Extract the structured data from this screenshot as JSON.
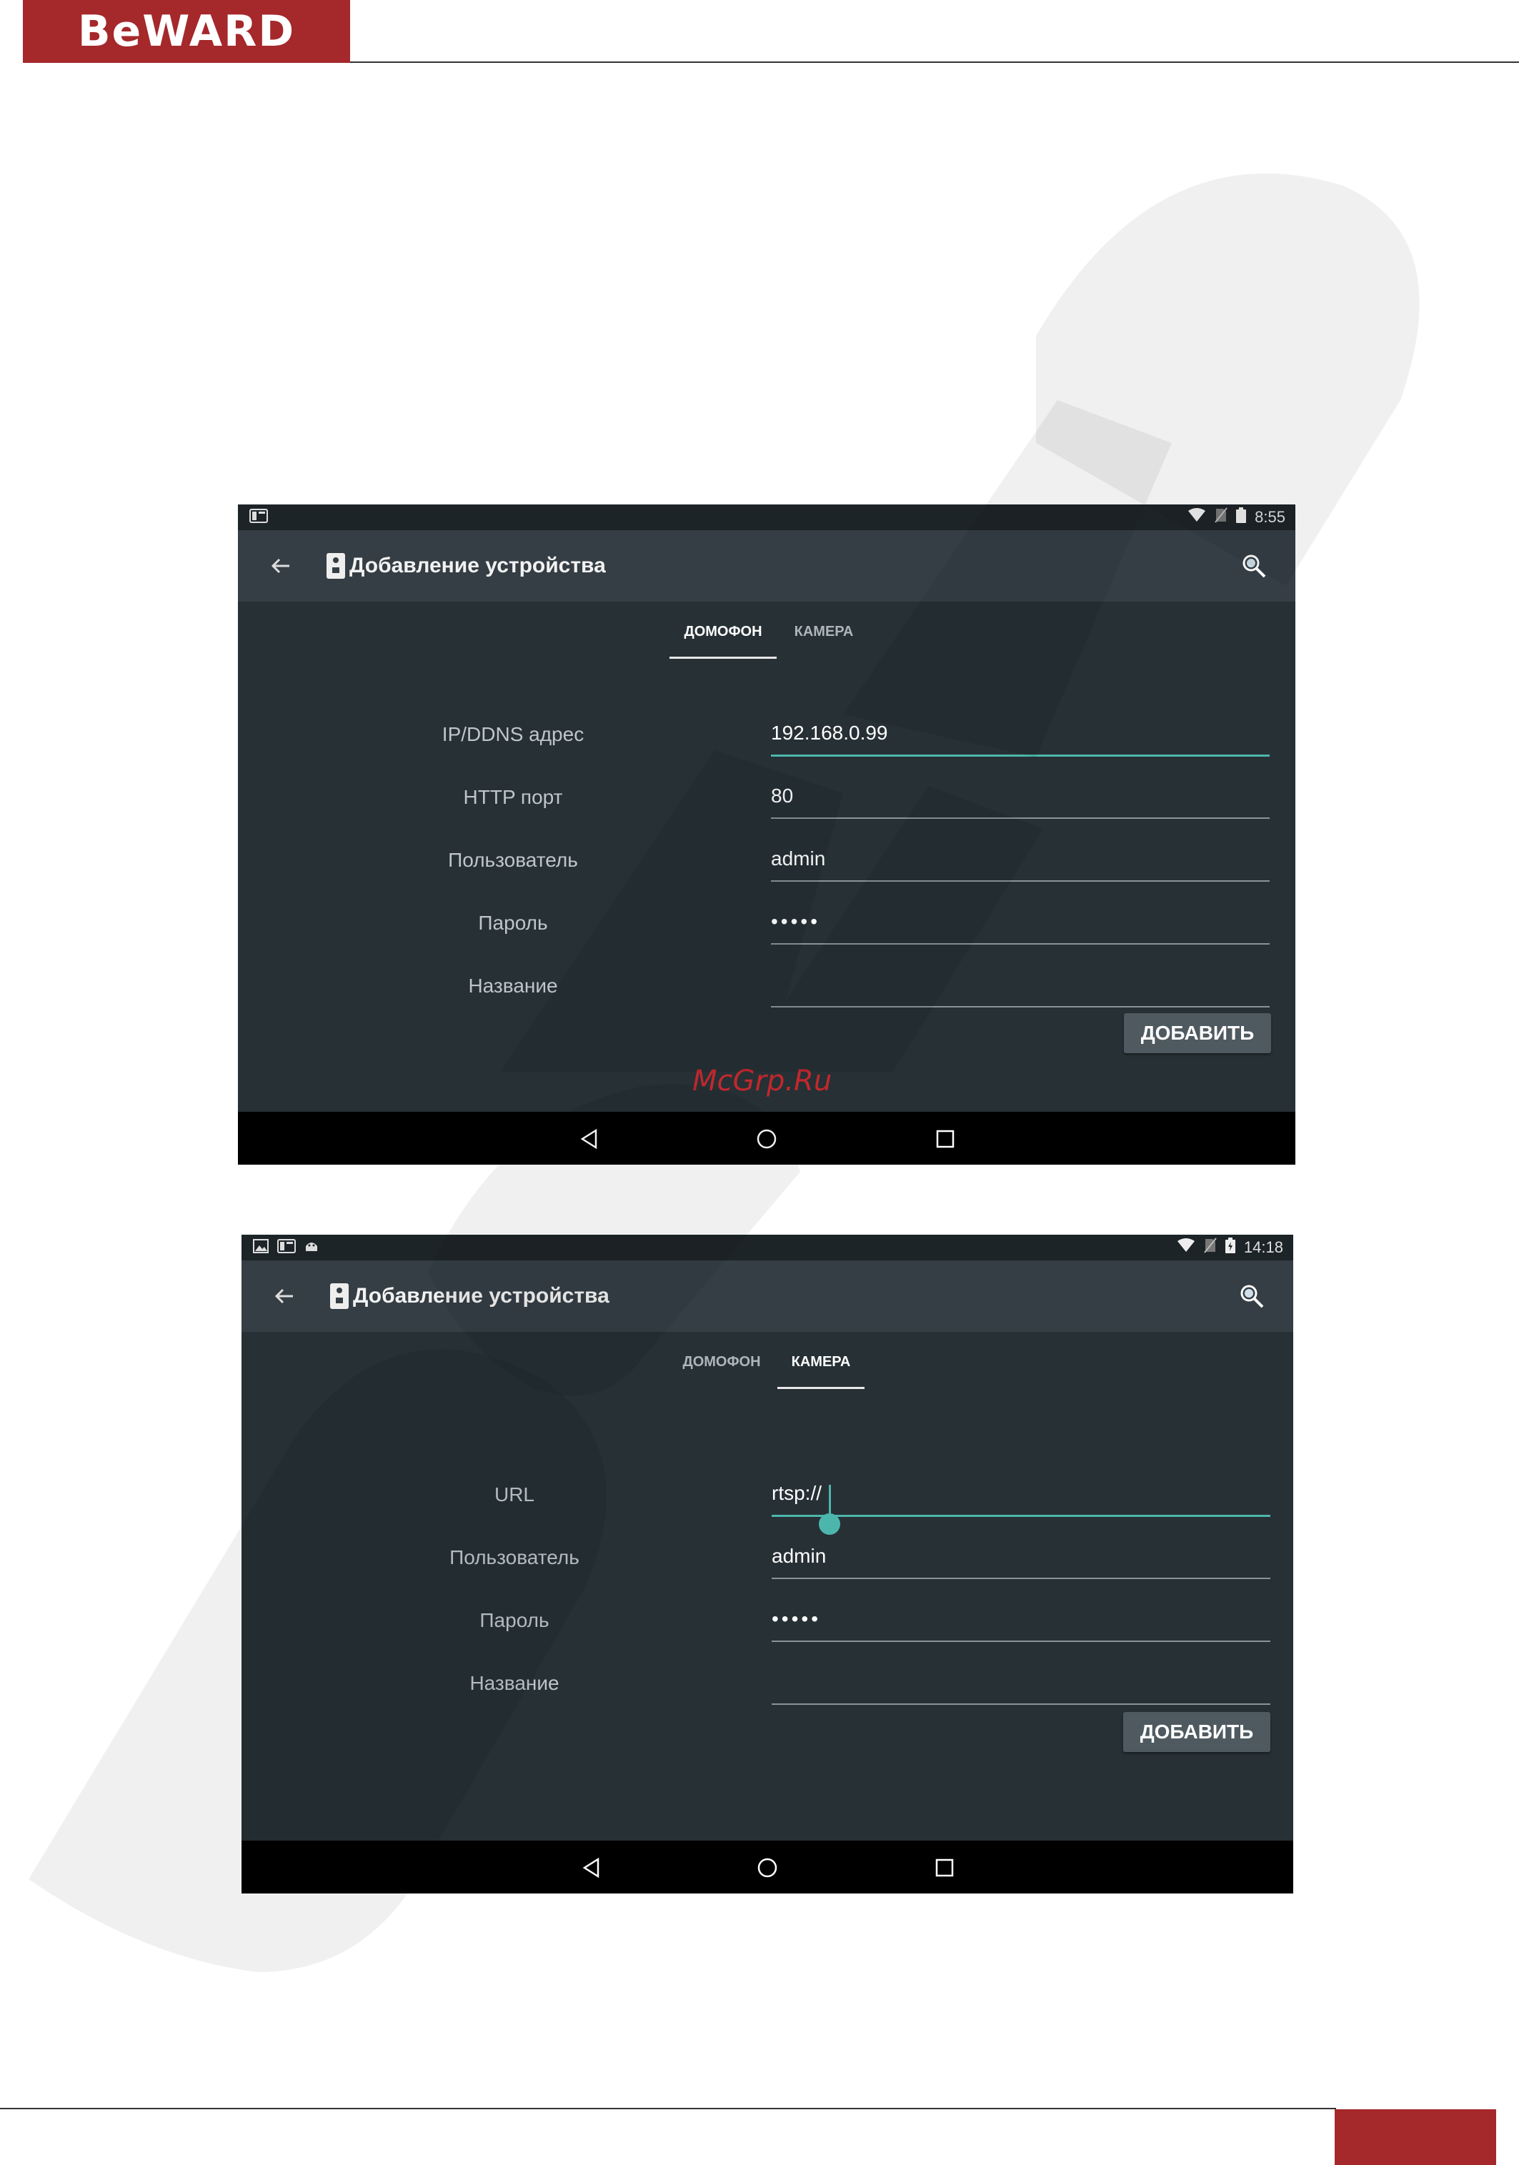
{
  "document": {
    "brand": "BeWARD"
  },
  "colors": {
    "brand_red": "#a5282b",
    "accent_teal": "#4db6ac",
    "screen_bg": "#263035",
    "app_bar": "#353e44"
  },
  "screen1": {
    "status_time": "8:55",
    "title": "Добавление устройства",
    "tabs": [
      {
        "label": "ДОМОФОН",
        "active": true
      },
      {
        "label": "КАМЕРА",
        "active": false
      }
    ],
    "fields": [
      {
        "label": "IP/DDNS адрес",
        "value": "192.168.0.99",
        "focused": true
      },
      {
        "label": "HTTP порт",
        "value": "80"
      },
      {
        "label": "Пользователь",
        "value": "admin"
      },
      {
        "label": "Пароль",
        "value": "•••••"
      },
      {
        "label": "Название",
        "value": ""
      }
    ],
    "add_button": "ДОБАВИТЬ",
    "site_watermark": "McGrp.Ru",
    "icons": [
      "back-arrow-icon",
      "intercom-icon",
      "search-icon",
      "wifi-icon",
      "no-sim-icon",
      "battery-icon",
      "nav-back-icon",
      "nav-home-icon",
      "nav-recents-icon"
    ]
  },
  "screen2": {
    "status_time": "14:18",
    "title": "Добавление устройства",
    "tabs": [
      {
        "label": "ДОМОФОН",
        "active": false
      },
      {
        "label": "КАМЕРА",
        "active": true
      }
    ],
    "fields": [
      {
        "label": "URL",
        "value": "rtsp://",
        "focused": true
      },
      {
        "label": "Пользователь",
        "value": "admin"
      },
      {
        "label": "Пароль",
        "value": "•••••"
      },
      {
        "label": "Название",
        "value": ""
      }
    ],
    "add_button": "ДОБАВИТЬ",
    "icons": [
      "image-icon",
      "intercom-icon",
      "android-icon",
      "wifi-icon",
      "no-sim-icon",
      "battery-charging-icon"
    ]
  }
}
